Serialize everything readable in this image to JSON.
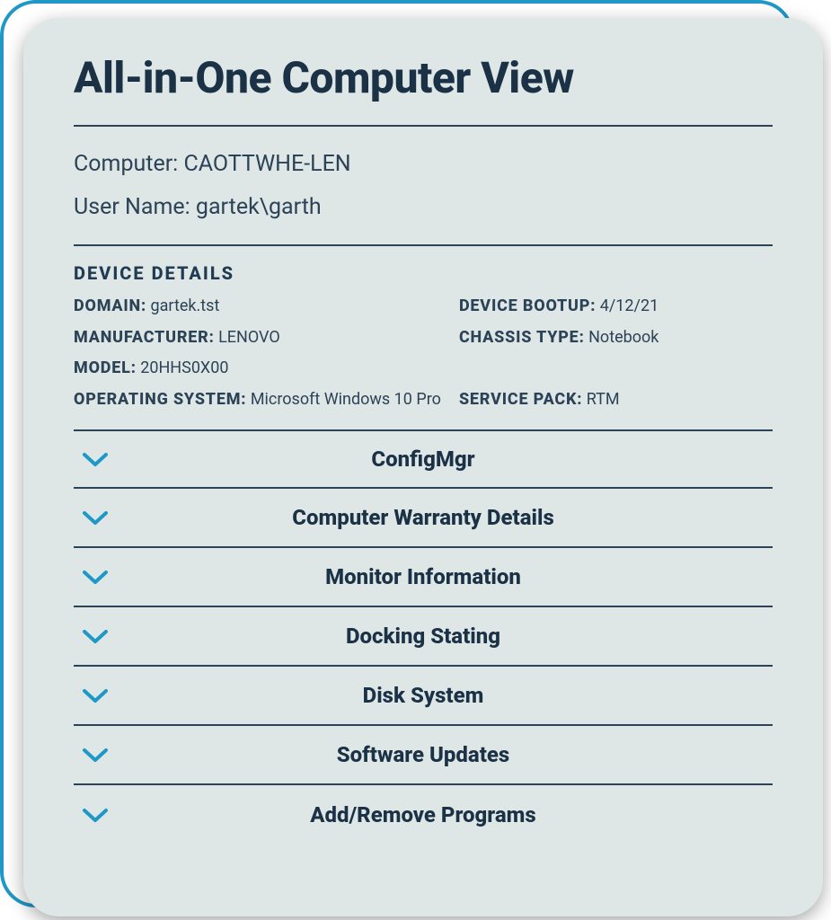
{
  "title": "All-in-One Computer View",
  "info": {
    "computer_label": "Computer:",
    "computer_value": "CAOTTWHE-LEN",
    "username_label": "User Name:",
    "username_value": "gartek\\garth"
  },
  "device_details": {
    "header": "DEVICE DETAILS",
    "domain": {
      "k": "DOMAIN:",
      "v": "gartek.tst"
    },
    "manufacturer": {
      "k": "MANUFACTURER:",
      "v": "LENOVO"
    },
    "model": {
      "k": "MODEL:",
      "v": "20HHS0X00"
    },
    "os": {
      "k": "OPERATING SYSTEM:",
      "v": "Microsoft Windows 10 Pro"
    },
    "bootup": {
      "k": "DEVICE BOOTUP:",
      "v": "4/12/21"
    },
    "chassis": {
      "k": "CHASSIS TYPE:",
      "v": "Notebook"
    },
    "service_pack": {
      "k": "SERVICE PACK:",
      "v": "RTM"
    }
  },
  "accordion": {
    "items": [
      {
        "label": "ConfigMgr"
      },
      {
        "label": "Computer Warranty Details"
      },
      {
        "label": "Monitor Information"
      },
      {
        "label": "Docking Stating"
      },
      {
        "label": "Disk System"
      },
      {
        "label": "Software Updates"
      },
      {
        "label": "Add/Remove Programs"
      }
    ]
  }
}
